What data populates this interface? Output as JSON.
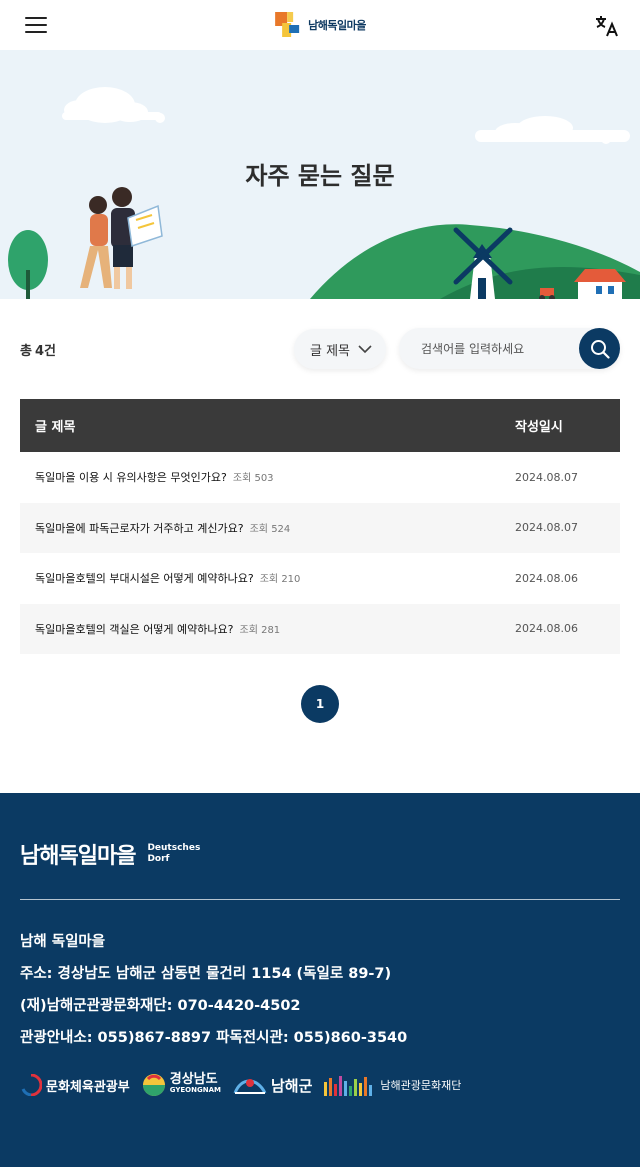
{
  "header": {
    "logo_text": "남해독일마을",
    "menu_icon": "hamburger-icon",
    "lang_icon": "translate-icon"
  },
  "hero": {
    "title": "자주 묻는 질문"
  },
  "toolbar": {
    "total_prefix": "총",
    "total_count": "4건",
    "select_value": "글 제목",
    "search_placeholder": "검색어를 입력하세요"
  },
  "table": {
    "headers": [
      "글 제목",
      "작성일시"
    ],
    "rows": [
      {
        "title": "독일마을 이용 시 유의사항은 무엇인가요?",
        "views": "조회 503",
        "date": "2024.08.07"
      },
      {
        "title": "독일마을에 파독근로자가 거주하고 계신가요?",
        "views": "조회 524",
        "date": "2024.08.07"
      },
      {
        "title": "독일마을호텔의 부대시설은 어떻게 예약하나요?",
        "views": "조회 210",
        "date": "2024.08.06"
      },
      {
        "title": "독일마을호텔의 객실은 어떻게 예약하나요?",
        "views": "조회 281",
        "date": "2024.08.06"
      }
    ]
  },
  "pagination": {
    "current": "1"
  },
  "footer": {
    "logo_kr": "남해독일마을",
    "logo_de_1": "Deutsches",
    "logo_de_2": "Dorf",
    "info": [
      "남해 독일마을",
      "주소: 경상남도 남해군 삼동면 물건리 1154 (독일로 89-7)",
      "(재)남해군관광문화재단: 070-4420-4502",
      "관광안내소: 055)867-8897  파독전시관: 055)860-3540"
    ],
    "partners": [
      "문화체육관광부",
      "경상남도",
      "GYEONGNAM",
      "남해군",
      "남해관광문화재단"
    ]
  },
  "colors": {
    "primary": "#0b3a63",
    "table_header": "#3a3a3a",
    "hero_bg": "#ebf3f9"
  }
}
